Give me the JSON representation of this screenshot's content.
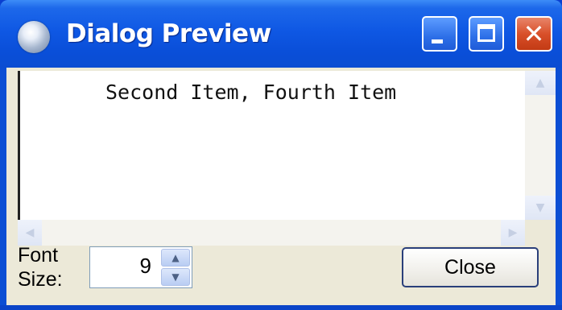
{
  "window": {
    "title": "Dialog Preview",
    "icon": "globe-app-icon",
    "controls": {
      "minimize_icon": "minimize-icon",
      "maximize_icon": "maximize-icon",
      "close_icon": "close-icon",
      "close_glyph": "✕"
    }
  },
  "content": {
    "text": "Second Item, Fourth Item"
  },
  "font_size": {
    "label": "Font Size:",
    "value": "9"
  },
  "buttons": {
    "close_label": "Close"
  },
  "colors": {
    "titlebar": "#0b4fd8",
    "close_button": "#d9502a",
    "client_bg": "#ece9d8"
  }
}
